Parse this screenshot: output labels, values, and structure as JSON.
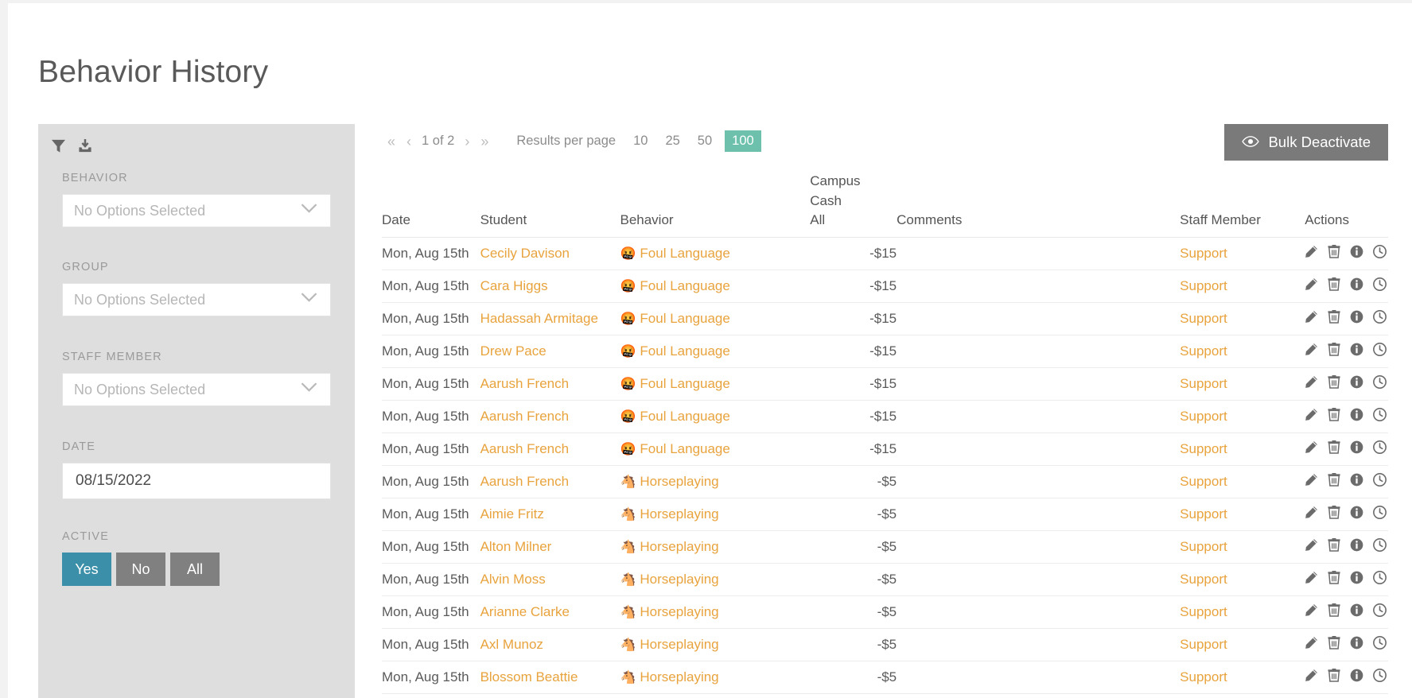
{
  "page": {
    "title": "Behavior History"
  },
  "sidebar": {
    "toolbar": {
      "filter_icon": "filter-icon",
      "export_icon": "download-icon"
    },
    "filters": [
      {
        "label": "Behavior",
        "value": "No Options Selected"
      },
      {
        "label": "Group",
        "value": "No Options Selected"
      },
      {
        "label": "Staff Member",
        "value": "No Options Selected"
      }
    ],
    "date": {
      "label": "Date",
      "value": "08/15/2022"
    },
    "active": {
      "label": "Active",
      "options": [
        "Yes",
        "No",
        "All"
      ],
      "selected": "Yes"
    }
  },
  "toolbar": {
    "pager": {
      "first": "«",
      "prev": "‹",
      "page_text": "1 of 2",
      "next": "›",
      "last": "»"
    },
    "results_per_page_label": "Results per page",
    "results_per_page_options": [
      "10",
      "25",
      "50",
      "100"
    ],
    "results_per_page_selected": "100",
    "bulk_deactivate_label": "Bulk Deactivate",
    "bulk_deactivate_icon": "eye-icon"
  },
  "table": {
    "columns": [
      "Date",
      "Student",
      "Behavior",
      "Campus\nCash\nAll",
      "Comments",
      "Staff Member",
      "Actions"
    ],
    "action_icons": [
      "pencil-icon",
      "trash-icon",
      "info-icon",
      "clock-icon"
    ],
    "rows": [
      {
        "date": "Mon, Aug 15th",
        "student": "Cecily Davison",
        "emoji": "🤬",
        "behavior": "Foul Language",
        "cash": "-$15",
        "comments": "",
        "staff": "Support"
      },
      {
        "date": "Mon, Aug 15th",
        "student": "Cara Higgs",
        "emoji": "🤬",
        "behavior": "Foul Language",
        "cash": "-$15",
        "comments": "",
        "staff": "Support"
      },
      {
        "date": "Mon, Aug 15th",
        "student": "Hadassah Armitage",
        "emoji": "🤬",
        "behavior": "Foul Language",
        "cash": "-$15",
        "comments": "",
        "staff": "Support"
      },
      {
        "date": "Mon, Aug 15th",
        "student": "Drew Pace",
        "emoji": "🤬",
        "behavior": "Foul Language",
        "cash": "-$15",
        "comments": "",
        "staff": "Support"
      },
      {
        "date": "Mon, Aug 15th",
        "student": "Aarush French",
        "emoji": "🤬",
        "behavior": "Foul Language",
        "cash": "-$15",
        "comments": "",
        "staff": "Support"
      },
      {
        "date": "Mon, Aug 15th",
        "student": "Aarush French",
        "emoji": "🤬",
        "behavior": "Foul Language",
        "cash": "-$15",
        "comments": "",
        "staff": "Support"
      },
      {
        "date": "Mon, Aug 15th",
        "student": "Aarush French",
        "emoji": "🤬",
        "behavior": "Foul Language",
        "cash": "-$15",
        "comments": "",
        "staff": "Support"
      },
      {
        "date": "Mon, Aug 15th",
        "student": "Aarush French",
        "emoji": "🐴",
        "behavior": "Horseplaying",
        "cash": "-$5",
        "comments": "",
        "staff": "Support"
      },
      {
        "date": "Mon, Aug 15th",
        "student": "Aimie Fritz",
        "emoji": "🐴",
        "behavior": "Horseplaying",
        "cash": "-$5",
        "comments": "",
        "staff": "Support"
      },
      {
        "date": "Mon, Aug 15th",
        "student": "Alton Milner",
        "emoji": "🐴",
        "behavior": "Horseplaying",
        "cash": "-$5",
        "comments": "",
        "staff": "Support"
      },
      {
        "date": "Mon, Aug 15th",
        "student": "Alvin Moss",
        "emoji": "🐴",
        "behavior": "Horseplaying",
        "cash": "-$5",
        "comments": "",
        "staff": "Support"
      },
      {
        "date": "Mon, Aug 15th",
        "student": "Arianne Clarke",
        "emoji": "🐴",
        "behavior": "Horseplaying",
        "cash": "-$5",
        "comments": "",
        "staff": "Support"
      },
      {
        "date": "Mon, Aug 15th",
        "student": "Axl Munoz",
        "emoji": "🐴",
        "behavior": "Horseplaying",
        "cash": "-$5",
        "comments": "",
        "staff": "Support"
      },
      {
        "date": "Mon, Aug 15th",
        "student": "Blossom Beattie",
        "emoji": "🐴",
        "behavior": "Horseplaying",
        "cash": "-$5",
        "comments": "",
        "staff": "Support"
      }
    ]
  },
  "colors": {
    "accent_link": "#e8a33d",
    "active_teal": "#3b8fa8",
    "badge_green": "#6cc0ac",
    "sidebar_bg": "#dedede",
    "button_gray": "#7a7a7a"
  }
}
